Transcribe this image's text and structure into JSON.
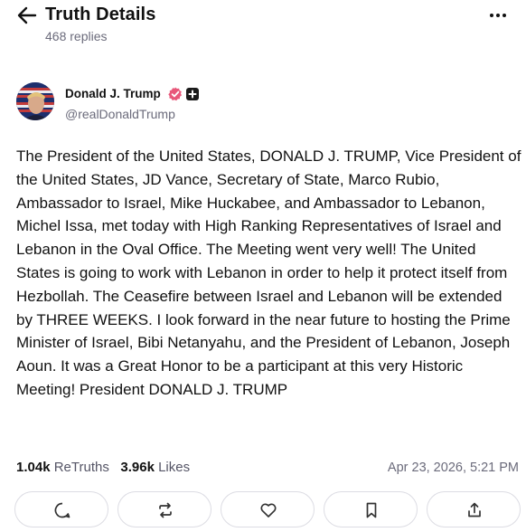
{
  "header": {
    "title": "Truth Details",
    "replies": "468 replies"
  },
  "author": {
    "name": "Donald J. Trump",
    "handle": "@realDonaldTrump"
  },
  "post": {
    "text": "The President of the United States, DONALD J. TRUMP, Vice President of the United States, JD Vance, Secretary of State, Marco Rubio, Ambassador to Israel, Mike Huckabee, and Ambassador to Lebanon, Michel Issa, met today with High Ranking Representatives of Israel and Lebanon in the Oval Office. The Meeting went very well! The United States is going to work with Lebanon in order to help it protect itself from Hezbollah. The Ceasefire between Israel and Lebanon will be extended by THREE WEEKS. I look forward in the near future to hosting the Prime Minister of Israel, Bibi Netanyahu, and the President of Lebanon, Joseph Aoun. It was a Great Honor to be a participant at this very Historic Meeting! President DONALD J. TRUMP"
  },
  "stats": {
    "retruths_count": "1.04k",
    "retruths_label": "ReTruths",
    "likes_count": "3.96k",
    "likes_label": "Likes",
    "timestamp": "Apr 23, 2026, 5:21 PM"
  },
  "actions": [
    "reply-icon",
    "retruth-icon",
    "like-icon",
    "bookmark-icon",
    "share-icon"
  ],
  "colors": {
    "verified_badge": "#e8577a",
    "muted_text": "#6b6b7b",
    "border": "#dcdce3"
  }
}
